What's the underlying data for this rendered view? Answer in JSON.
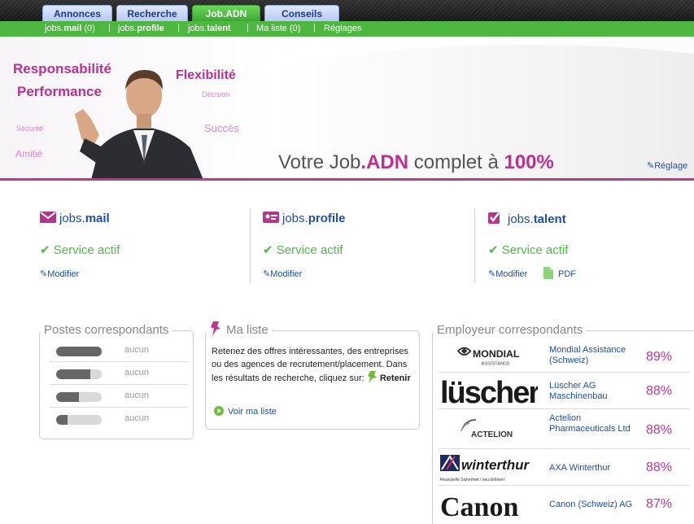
{
  "tabs": [
    {
      "label": "Annonces",
      "active": false
    },
    {
      "label": "Recherche",
      "active": false
    },
    {
      "label": "Job.ADN",
      "active": true
    },
    {
      "label": "Conseils",
      "active": false
    }
  ],
  "subnav": {
    "mail_prefix": "jobs.",
    "mail_bold": "mail",
    "mail_count": " (0)",
    "profile_prefix": "jobs.",
    "profile_bold": "profile",
    "talent_prefix": "jobs.",
    "talent_bold": "talent",
    "maliste": "Ma liste (0)",
    "reglages": "Réglages"
  },
  "hero": {
    "words": {
      "responsabilite": "Responsabilité",
      "performance": "Performance",
      "flexibilite": "Flexibilité",
      "decision": "Décision",
      "securite": "Sécurité",
      "succes": "Succès",
      "amitie": "Amitié"
    },
    "title_prefix": "Votre Job",
    "title_adn": ".ADN",
    "title_mid": " complet à ",
    "title_pct": "100%",
    "reglage_link": "Réglage"
  },
  "services": [
    {
      "prefix": "jobs.",
      "name": "mail",
      "status": "Service actif",
      "modify": "Modifier"
    },
    {
      "prefix": "jobs.",
      "name": "profile",
      "status": "Service actif",
      "modify": "Modifier"
    },
    {
      "prefix": "jobs.",
      "name": "talent",
      "status": "Service actif",
      "modify": "Modifier",
      "pdf": "PDF"
    }
  ],
  "postes": {
    "title": "Postes correspondants",
    "rows": [
      {
        "value": "aucun",
        "fill": 1.0
      },
      {
        "value": "aucun",
        "fill": 0.75
      },
      {
        "value": "aucun",
        "fill": 0.5
      },
      {
        "value": "aucun",
        "fill": 0.25
      }
    ]
  },
  "ma_liste": {
    "title": "Ma liste",
    "text_before": "Retenez des offres intéressantes, des entreprises ou des agences de recrutement/placement. Dans les résultats de recherche, cliquez sur:",
    "retenir": "Retenir",
    "voir": "Voir ma liste"
  },
  "employeurs": {
    "title": "Employeur correspondants",
    "rows": [
      {
        "logo": "MONDIAL",
        "logo_sub": "ASSISTANCE",
        "name": "Mondial Assistance (Schweiz)",
        "pct": "89%"
      },
      {
        "logo": "lüscher",
        "name": "Lüscher AG Maschinenbau",
        "pct": "88%"
      },
      {
        "logo": "ACTELION",
        "name": "Actelion Pharmaceuticals Ltd",
        "pct": "88%"
      },
      {
        "logo": "winterthur",
        "logo_sub": "Finanzielle Sicherheit / neu definiert",
        "name": "AXA Winterthur",
        "pct": "88%"
      },
      {
        "logo": "Canon",
        "name": "Canon (Schweiz) AG",
        "pct": "87%"
      }
    ]
  },
  "colors": {
    "accent": "#bf2f8f",
    "green": "#4cb83f",
    "link": "#1d4fa8"
  }
}
